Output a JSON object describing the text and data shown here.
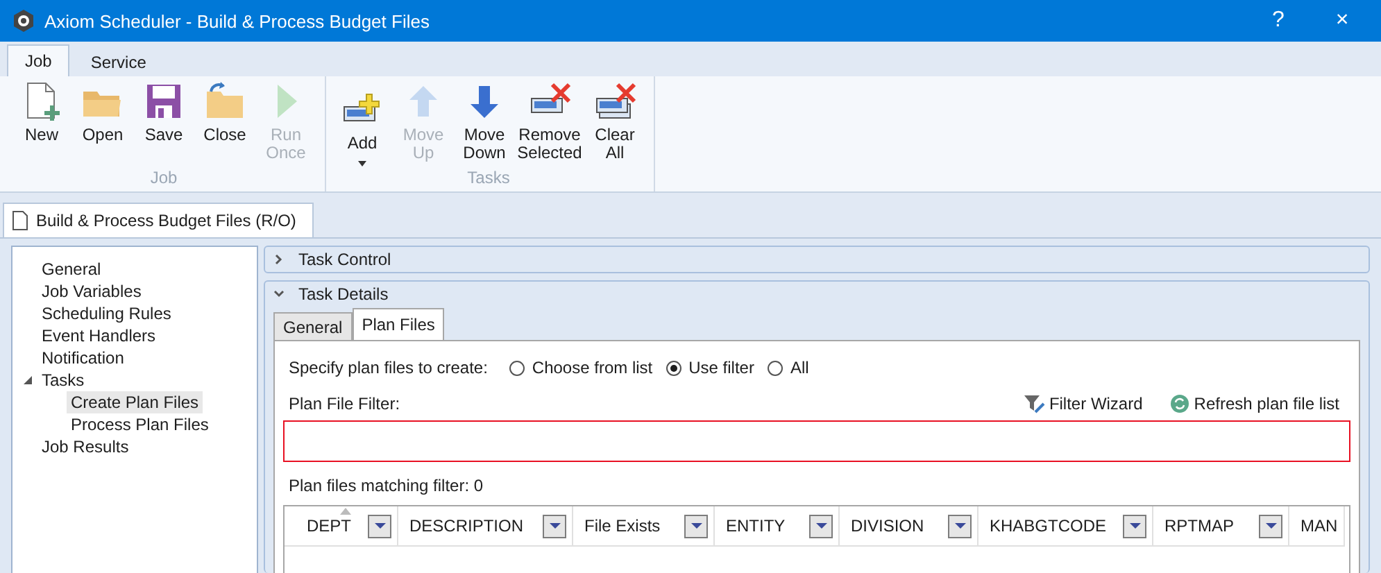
{
  "window": {
    "title": "Axiom Scheduler - Build & Process Budget Files",
    "help": "?",
    "close": "×"
  },
  "ribbon_tabs": [
    {
      "label": "Job",
      "selected": true
    },
    {
      "label": "Service",
      "selected": false
    }
  ],
  "ribbon_groups": [
    {
      "label": "Job",
      "buttons": [
        {
          "kind": "new",
          "label": "New",
          "disabled": false
        },
        {
          "kind": "open",
          "label": "Open",
          "disabled": false
        },
        {
          "kind": "save",
          "label": "Save",
          "disabled": false
        },
        {
          "kind": "close",
          "label": "Close",
          "disabled": false
        },
        {
          "kind": "run",
          "label": "Run Once",
          "disabled": true
        }
      ]
    },
    {
      "label": "Tasks",
      "buttons": [
        {
          "kind": "add",
          "label": "Add",
          "disabled": false,
          "dropdown": true
        },
        {
          "kind": "up",
          "label": "Move Up",
          "disabled": true
        },
        {
          "kind": "down",
          "label": "Move Down",
          "disabled": false
        },
        {
          "kind": "remove",
          "label": "Remove Selected",
          "disabled": false
        },
        {
          "kind": "clear",
          "label": "Clear All",
          "disabled": false
        }
      ]
    }
  ],
  "document_tab": {
    "label": "Build & Process Budget Files (R/O)"
  },
  "sidebar": {
    "items": [
      {
        "label": "General",
        "selected": false
      },
      {
        "label": "Job Variables",
        "selected": false
      },
      {
        "label": "Scheduling Rules",
        "selected": false
      },
      {
        "label": "Event Handlers",
        "selected": false
      },
      {
        "label": "Notification",
        "selected": false
      },
      {
        "label": "Tasks",
        "selected": false,
        "expanded": true,
        "children": [
          {
            "label": "Create Plan Files",
            "selected": true
          },
          {
            "label": "Process Plan Files",
            "selected": false
          }
        ]
      },
      {
        "label": "Job Results",
        "selected": false
      }
    ]
  },
  "sections": [
    {
      "title": "Task Control",
      "expanded": false
    },
    {
      "title": "Task Details",
      "expanded": true
    }
  ],
  "detail_tabs": [
    {
      "label": "General",
      "selected": false
    },
    {
      "label": "Plan Files",
      "selected": true
    }
  ],
  "plan_files": {
    "prompt": "Specify plan files to create:",
    "options": [
      {
        "label": "Choose from list",
        "selected": false
      },
      {
        "label": "Use filter",
        "selected": true
      },
      {
        "label": "All",
        "selected": false
      }
    ],
    "filter_label": "Plan File Filter:",
    "filter_wizard": "Filter Wizard",
    "refresh": "Refresh plan file list",
    "matching": "Plan files matching filter: 0"
  },
  "table": {
    "columns": [
      {
        "label": "DEPT",
        "sorted": true
      },
      {
        "label": "DESCRIPTION",
        "sorted": false
      },
      {
        "label": "File Exists",
        "sorted": false
      },
      {
        "label": "ENTITY",
        "sorted": false
      },
      {
        "label": "DIVISION",
        "sorted": false
      },
      {
        "label": "KHABGTCODE",
        "sorted": false
      },
      {
        "label": "RPTMAP",
        "sorted": false
      },
      {
        "label": "MAN",
        "sorted": false
      }
    ]
  }
}
